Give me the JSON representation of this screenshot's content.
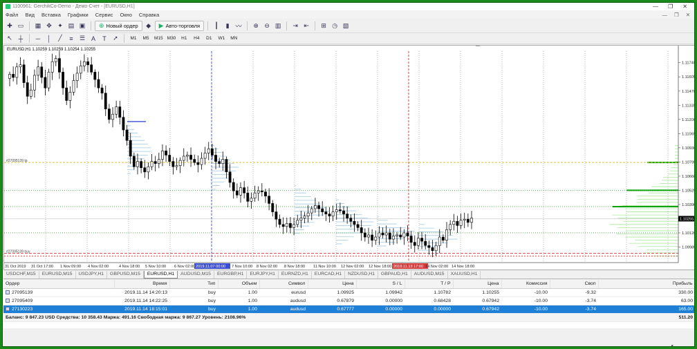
{
  "window": {
    "title": "1100961: GerchikCo-Demo - Демо-Счет - [EURUSD,H1]",
    "controls": [
      "—",
      "❐",
      "✕"
    ]
  },
  "menu": {
    "items": [
      "Файл",
      "Вид",
      "Вставка",
      "Графики",
      "Сервис",
      "Окно",
      "Справка"
    ],
    "mdi_controls": [
      "—",
      "❐",
      "✕"
    ]
  },
  "toolbar": {
    "new_order_label": "Новый ордер",
    "auto_trading_label": "Авто-торговля",
    "timeframes": [
      "M1",
      "M5",
      "M15",
      "M30",
      "H1",
      "H4",
      "D1",
      "W1",
      "MN"
    ]
  },
  "chart": {
    "info_label": "EURUSD,H1  1.10259 1.10259 1.10254 1.10255",
    "current_price": "1.10255",
    "order_label_tp": "#27095139 tp",
    "order_label_buy": "#27095139 buy",
    "price_ticks": [
      "1.11740",
      "1.11605",
      "1.11470",
      "1.11335",
      "1.11200",
      "1.11065",
      "1.10930",
      "1.10795",
      "1.10660",
      "1.10525",
      "1.10390",
      "1.10255",
      "1.10120",
      "1.09985"
    ],
    "time_ticks": [
      "31 Oct 2019",
      "31 Oct 17:00",
      "1 Nov 09:00",
      "4 Nov 02:00",
      "4 Nov 18:00",
      "5 Nov 10:00",
      "6 Nov 02:00",
      "2019.11.07 00:00",
      "7 Nov 10:00",
      "8 Nov 02:00",
      "8 Nov 18:00",
      "11 Nov 10:00",
      "12 Nov 02:00",
      "12 Nov 18:00",
      "2019.11.13 17:00",
      "14 Nov 02:00",
      "14 Nov 18:00"
    ],
    "colors": {
      "candle": "#000000",
      "profile": "#9fc8e6",
      "profile_right": "#a8e89a",
      "poc": "#00a000",
      "grid": "#cfcfcf",
      "tp_line": "#d9c23a",
      "level_green": "#3fae3f",
      "level_red": "#d04040"
    }
  },
  "chart_data": {
    "type": "candlestick",
    "symbol": "EURUSD",
    "timeframe": "H1",
    "ylim": [
      1.0985,
      1.1185
    ],
    "close": [
      1.1163,
      1.116,
      1.117,
      1.1172,
      1.1155,
      1.1142,
      1.1148,
      1.1162,
      1.117,
      1.116,
      1.115,
      1.1165,
      1.1175,
      1.1178,
      1.1165,
      1.115,
      1.1138,
      1.1146,
      1.1157,
      1.1164,
      1.1171,
      1.1175,
      1.1172,
      1.1165,
      1.1158,
      1.115,
      1.1145,
      1.113,
      1.112,
      1.1125,
      1.1132,
      1.1122,
      1.111,
      1.11,
      1.1085,
      1.1075,
      1.108,
      1.1074,
      1.107,
      1.1075,
      1.108,
      1.1078,
      1.1082,
      1.109,
      1.1086,
      1.108,
      1.1075,
      1.1076,
      1.1081,
      1.1085,
      1.1086,
      1.1082,
      1.1079,
      1.1077,
      1.1083,
      1.1088,
      1.1092,
      1.1086,
      1.108,
      1.1078,
      1.1082,
      1.107,
      1.106,
      1.1052,
      1.1048,
      1.1055,
      1.105,
      1.1042,
      1.1045,
      1.105,
      1.1052,
      1.1051,
      1.1047,
      1.104,
      1.1032,
      1.1025,
      1.102,
      1.1018,
      1.1021,
      1.1017,
      1.102,
      1.1024,
      1.1026,
      1.1028,
      1.1031,
      1.1035,
      1.1038,
      1.1035,
      1.1032,
      1.103,
      1.1028,
      1.1032,
      1.1034,
      1.1033,
      1.103,
      1.1026,
      1.1023,
      1.102,
      1.1017,
      1.1012,
      1.1008,
      1.101,
      1.1005,
      1.1008,
      1.1012,
      1.101,
      1.1012,
      1.1006,
      1.1009,
      1.101,
      1.1008,
      1.1012,
      1.1009,
      1.1003,
      1.1,
      1.1007,
      1.1004,
      1.1,
      1.0998,
      1.0995,
      1.1,
      1.1008,
      1.1005,
      1.1015,
      1.102,
      1.1023,
      1.1019,
      1.1024,
      1.1025,
      1.1022,
      1.1026
    ]
  },
  "symbol_tabs": [
    "USDCHF,M15",
    "EURUSD,M15",
    "USDJPY,H1",
    "GBPUSD,M15",
    "EURUSD,H1",
    "AUDUSD,M15",
    "EURGBP,H1",
    "EURJPY,H1",
    "EURNZD,H1",
    "EURCAD,H1",
    "NZDUSD,H1",
    "GBPAUD,H1",
    "AUDUSD,M15",
    "XAUUSD,H1"
  ],
  "active_tab_index": 4,
  "terminal": {
    "columns": [
      "Ордер",
      "Время",
      "Тип",
      "Объем",
      "Символ",
      "Цена",
      "S / L",
      "T / P",
      "Цена",
      "Комиссия",
      "Своп",
      "Прибыль"
    ],
    "rows": [
      [
        "27095139",
        "2019.11.14 14:20:13",
        "buy",
        "1.00",
        "eurusd",
        "1.09925",
        "1.09942",
        "1.10782",
        "1.10255",
        "-10.00",
        "-9.32",
        "330.00"
      ],
      [
        "27095409",
        "2019.11.14 14:22:25",
        "buy",
        "1.00",
        "audusd",
        "0.67879",
        "0.00000",
        "0.68428",
        "0.67942",
        "-10.00",
        "-3.74",
        "63.00"
      ],
      [
        "27130223",
        "2019.11.14 18:15:01",
        "buy",
        "1.00",
        "audusd",
        "0.67777",
        "0.00000",
        "0.00000",
        "0.67942",
        "-10.00",
        "-3.74",
        "165.00"
      ]
    ],
    "selected_row": 2,
    "summary": "Баланс: 9 847.23 USD  Средства: 10 358.43  Маржа: 491.16  Свободная маржа: 9 867.27  Уровень: 2108.96%",
    "summary_profit": "511.20"
  }
}
